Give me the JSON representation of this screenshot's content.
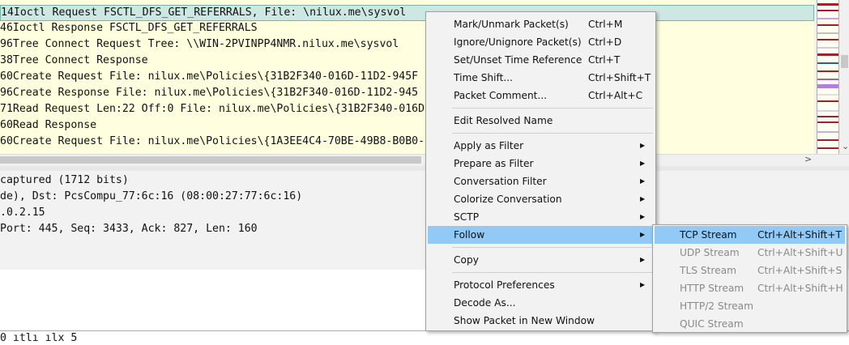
{
  "packet_list": {
    "rows": [
      {
        "prefix": "14",
        "info": "Ioctl Request FSCTL_DFS_GET_REFERRALS, File: \\nilux.me\\sysvol",
        "selected": true
      },
      {
        "prefix": "46",
        "info": "Ioctl Response FSCTL_DFS_GET_REFERRALS",
        "selected": false
      },
      {
        "prefix": "96",
        "info": "Tree Connect Request Tree: \\\\WIN-2PVINPP4NMR.nilux.me\\sysvol",
        "selected": false
      },
      {
        "prefix": "38",
        "info": "Tree Connect Response",
        "selected": false
      },
      {
        "prefix": "60",
        "info": "Create Request File: nilux.me\\Policies\\{31B2F340-016D-11D2-945F",
        "selected": false
      },
      {
        "prefix": "96",
        "info": "Create Response File: nilux.me\\Policies\\{31B2F340-016D-11D2-945",
        "selected": false
      },
      {
        "prefix": "71",
        "info": "Read Request Len:22 Off:0 File: nilux.me\\Policies\\{31B2F340-016D",
        "selected": false
      },
      {
        "prefix": "60",
        "info": "Read Response",
        "selected": false
      },
      {
        "prefix": "60",
        "info": "Create Request File: nilux.me\\Policies\\{1A3EE4C4-70BE-49B8-B0B0-",
        "selected": false
      }
    ]
  },
  "scroll_arrow_right": ">",
  "scroll_arrow_left": "<",
  "details": {
    "lines": [
      " captured (1712 bits)",
      "de), Dst: PcsCompu_77:6c:16 (08:00:27:77:6c:16)",
      ".0.2.15",
      " Port: 445, Seq: 3433, Ack: 827, Len: 160"
    ]
  },
  "bytes": {
    "partial_line": "0    ıtlı  ılx  5"
  },
  "context_menu": {
    "items": [
      {
        "label": "Mark/Unmark Packet(s)",
        "shortcut": "Ctrl+M"
      },
      {
        "label": "Ignore/Unignore Packet(s)",
        "shortcut": "Ctrl+D"
      },
      {
        "label": "Set/Unset Time Reference",
        "shortcut": "Ctrl+T"
      },
      {
        "label": "Time Shift...",
        "shortcut": "Ctrl+Shift+T"
      },
      {
        "label": "Packet Comment...",
        "shortcut": "Ctrl+Alt+C"
      },
      {
        "label": "Edit Resolved Name"
      },
      {
        "label": "Apply as Filter",
        "submenu": true
      },
      {
        "label": "Prepare as Filter",
        "submenu": true
      },
      {
        "label": "Conversation Filter",
        "submenu": true
      },
      {
        "label": "Colorize Conversation",
        "submenu": true
      },
      {
        "label": "SCTP",
        "submenu": true
      },
      {
        "label": "Follow",
        "submenu": true,
        "highlighted": true
      },
      {
        "label": "Copy",
        "submenu": true
      },
      {
        "label": "Protocol Preferences",
        "submenu": true
      },
      {
        "label": "Decode As..."
      },
      {
        "label": "Show Packet in New Window"
      }
    ],
    "submenu_arrow": "▶"
  },
  "follow_submenu": {
    "items": [
      {
        "label": "TCP Stream",
        "shortcut": "Ctrl+Alt+Shift+T",
        "enabled": true,
        "highlighted": true
      },
      {
        "label": "UDP Stream",
        "shortcut": "Ctrl+Alt+Shift+U",
        "enabled": false
      },
      {
        "label": "TLS Stream",
        "shortcut": "Ctrl+Alt+Shift+S",
        "enabled": false
      },
      {
        "label": "HTTP Stream",
        "shortcut": "Ctrl+Alt+Shift+H",
        "enabled": false
      },
      {
        "label": "HTTP/2 Stream",
        "enabled": false
      },
      {
        "label": "QUIC Stream",
        "enabled": false
      }
    ]
  },
  "colors": {
    "row_background": "#ffffe0",
    "selected_row": "#cde8e2",
    "menu_highlight": "#91c9f7",
    "disabled_text": "#8a8a8a"
  }
}
